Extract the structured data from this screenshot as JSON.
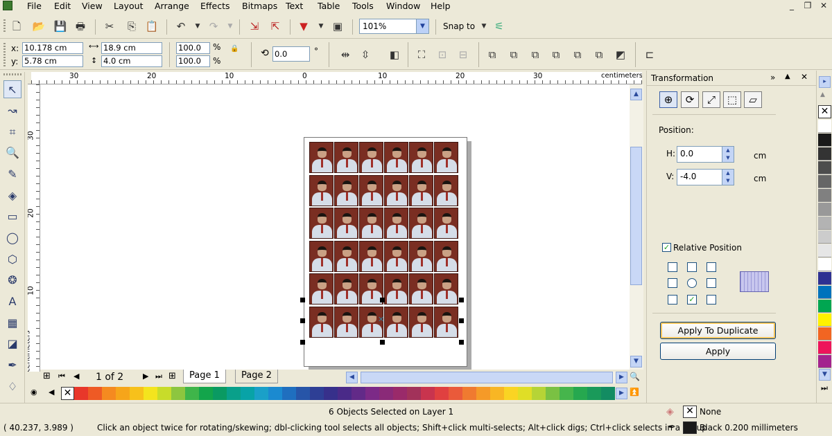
{
  "menu": [
    "File",
    "Edit",
    "View",
    "Layout",
    "Arrange",
    "Effects",
    "Bitmaps",
    "Text",
    "Table",
    "Tools",
    "Window",
    "Help"
  ],
  "window_controls": {
    "minimize": "_",
    "restore": "❐",
    "close": "✕"
  },
  "toolbar_standard": {
    "zoom_value": "101%",
    "snap_to_label": "Snap to"
  },
  "property_bar": {
    "x_label": "x:",
    "x_value": "10.178 cm",
    "y_label": "y:",
    "y_value": "5.78 cm",
    "width_value": "18.9 cm",
    "height_value": "4.0 cm",
    "scale_w": "100.0",
    "scale_h": "100.0",
    "percent": "%",
    "rotation_value": "0.0",
    "degree": "°"
  },
  "ruler": {
    "unit": "centimeters",
    "h_labels": [
      "30",
      "20",
      "10",
      "0",
      "10",
      "20",
      "30"
    ],
    "v_labels": [
      "30",
      "20",
      "10"
    ]
  },
  "page_nav": {
    "current": "1 of 2",
    "tabs": [
      "Page 1",
      "Page 2"
    ]
  },
  "photo_grid": {
    "rows": 6,
    "cols": 6
  },
  "status": {
    "selection": "6 Objects Selected on Layer 1",
    "coords": "( 40.237, 3.989 )",
    "hint": "Click an object twice for rotating/skewing; dbl-clicking tool selects all objects; Shift+click multi-selects; Alt+click digs; Ctrl+click selects in a group",
    "fill": "None",
    "outline": "Black  0.200 millimeters"
  },
  "docker": {
    "title": "Transformation",
    "position_label": "Position:",
    "h_label": "H:",
    "h_value": "0.0",
    "v_label": "V:",
    "v_value": "-4.0",
    "unit": "cm",
    "relative_label": "Relative Position",
    "relative_checked": true,
    "apply_duplicate": "Apply To Duplicate",
    "apply": "Apply"
  },
  "palette_colors": [
    "#e8372a",
    "#ee5a25",
    "#f58a20",
    "#f6a51a",
    "#f7c11b",
    "#f4e41e",
    "#c8dc2a",
    "#8dc63f",
    "#3fb54a",
    "#13a54b",
    "#0a9a62",
    "#09a08a",
    "#08a3a7",
    "#1aa0c8",
    "#1b8ad0",
    "#1f6fbf",
    "#2755a8",
    "#2e3f95",
    "#37308b",
    "#4a2a88",
    "#622a88",
    "#7c2a87",
    "#8a2a78",
    "#9a2a6a",
    "#a2325a",
    "#c9344e",
    "#e04040",
    "#ea5a3a",
    "#f07a30",
    "#f59a28",
    "#f8b624",
    "#fad423",
    "#e0de26",
    "#b6d436",
    "#7ac143",
    "#46b54c",
    "#26a84f",
    "#1a9a5a",
    "#138c62"
  ],
  "color_palette_right": [
    "#ffffff",
    "#1a1a1a",
    "#333333",
    "#4d4d4d",
    "#666666",
    "#808080",
    "#999999",
    "#b3b3b3",
    "#cccccc",
    "#e6e6e6",
    "#ffffff",
    "#2e3192",
    "#0072bc",
    "#00a651",
    "#fff200",
    "#f26522",
    "#ed145b",
    "#a3238e"
  ]
}
